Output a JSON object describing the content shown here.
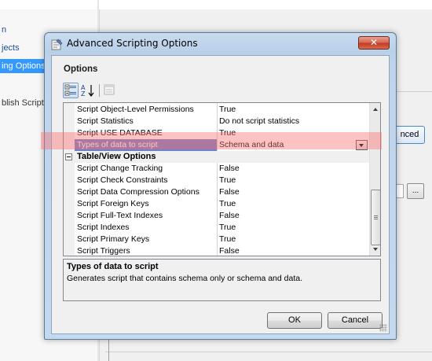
{
  "background": {
    "nav_items": [
      {
        "label": "n"
      },
      {
        "label": "jects"
      },
      {
        "label": "ing Options"
      },
      {
        "label": "blish Scripts"
      }
    ],
    "advanced_button": "nced",
    "ellipsis_button": "..."
  },
  "dialog": {
    "title": "Advanced Scripting Options",
    "close_glyph": "✕",
    "section_label": "Options",
    "toolbar": {
      "categorized_icon": "categorized-icon",
      "alphabetical_icon": "alphabetical-icon",
      "property_pages_icon": "property-pages-icon"
    },
    "grid": {
      "rows": [
        {
          "name": "Script Object-Level Permissions",
          "value": "True"
        },
        {
          "name": "Script Statistics",
          "value": "Do not script statistics"
        },
        {
          "name": "Script USE DATABASE",
          "value": "True"
        },
        {
          "name": "Types of data to script",
          "value": "Schema and data",
          "selected": true
        },
        {
          "name": "Table/View Options",
          "value": "",
          "category": true
        },
        {
          "name": "Script Change Tracking",
          "value": "False"
        },
        {
          "name": "Script Check Constraints",
          "value": "True"
        },
        {
          "name": "Script Data Compression Options",
          "value": "False"
        },
        {
          "name": "Script Foreign Keys",
          "value": "True"
        },
        {
          "name": "Script Full-Text Indexes",
          "value": "False"
        },
        {
          "name": "Script Indexes",
          "value": "True"
        },
        {
          "name": "Script Primary Keys",
          "value": "True"
        },
        {
          "name": "Script Triggers",
          "value": "False"
        }
      ]
    },
    "description": {
      "title": "Types of data to script",
      "text": "Generates script that contains schema only or schema and data."
    },
    "buttons": {
      "ok": "OK",
      "cancel": "Cancel"
    }
  },
  "colors": {
    "selection": "#6f82c5",
    "highlight": "#ff6e6e",
    "nav_selected": "#3399ff"
  }
}
